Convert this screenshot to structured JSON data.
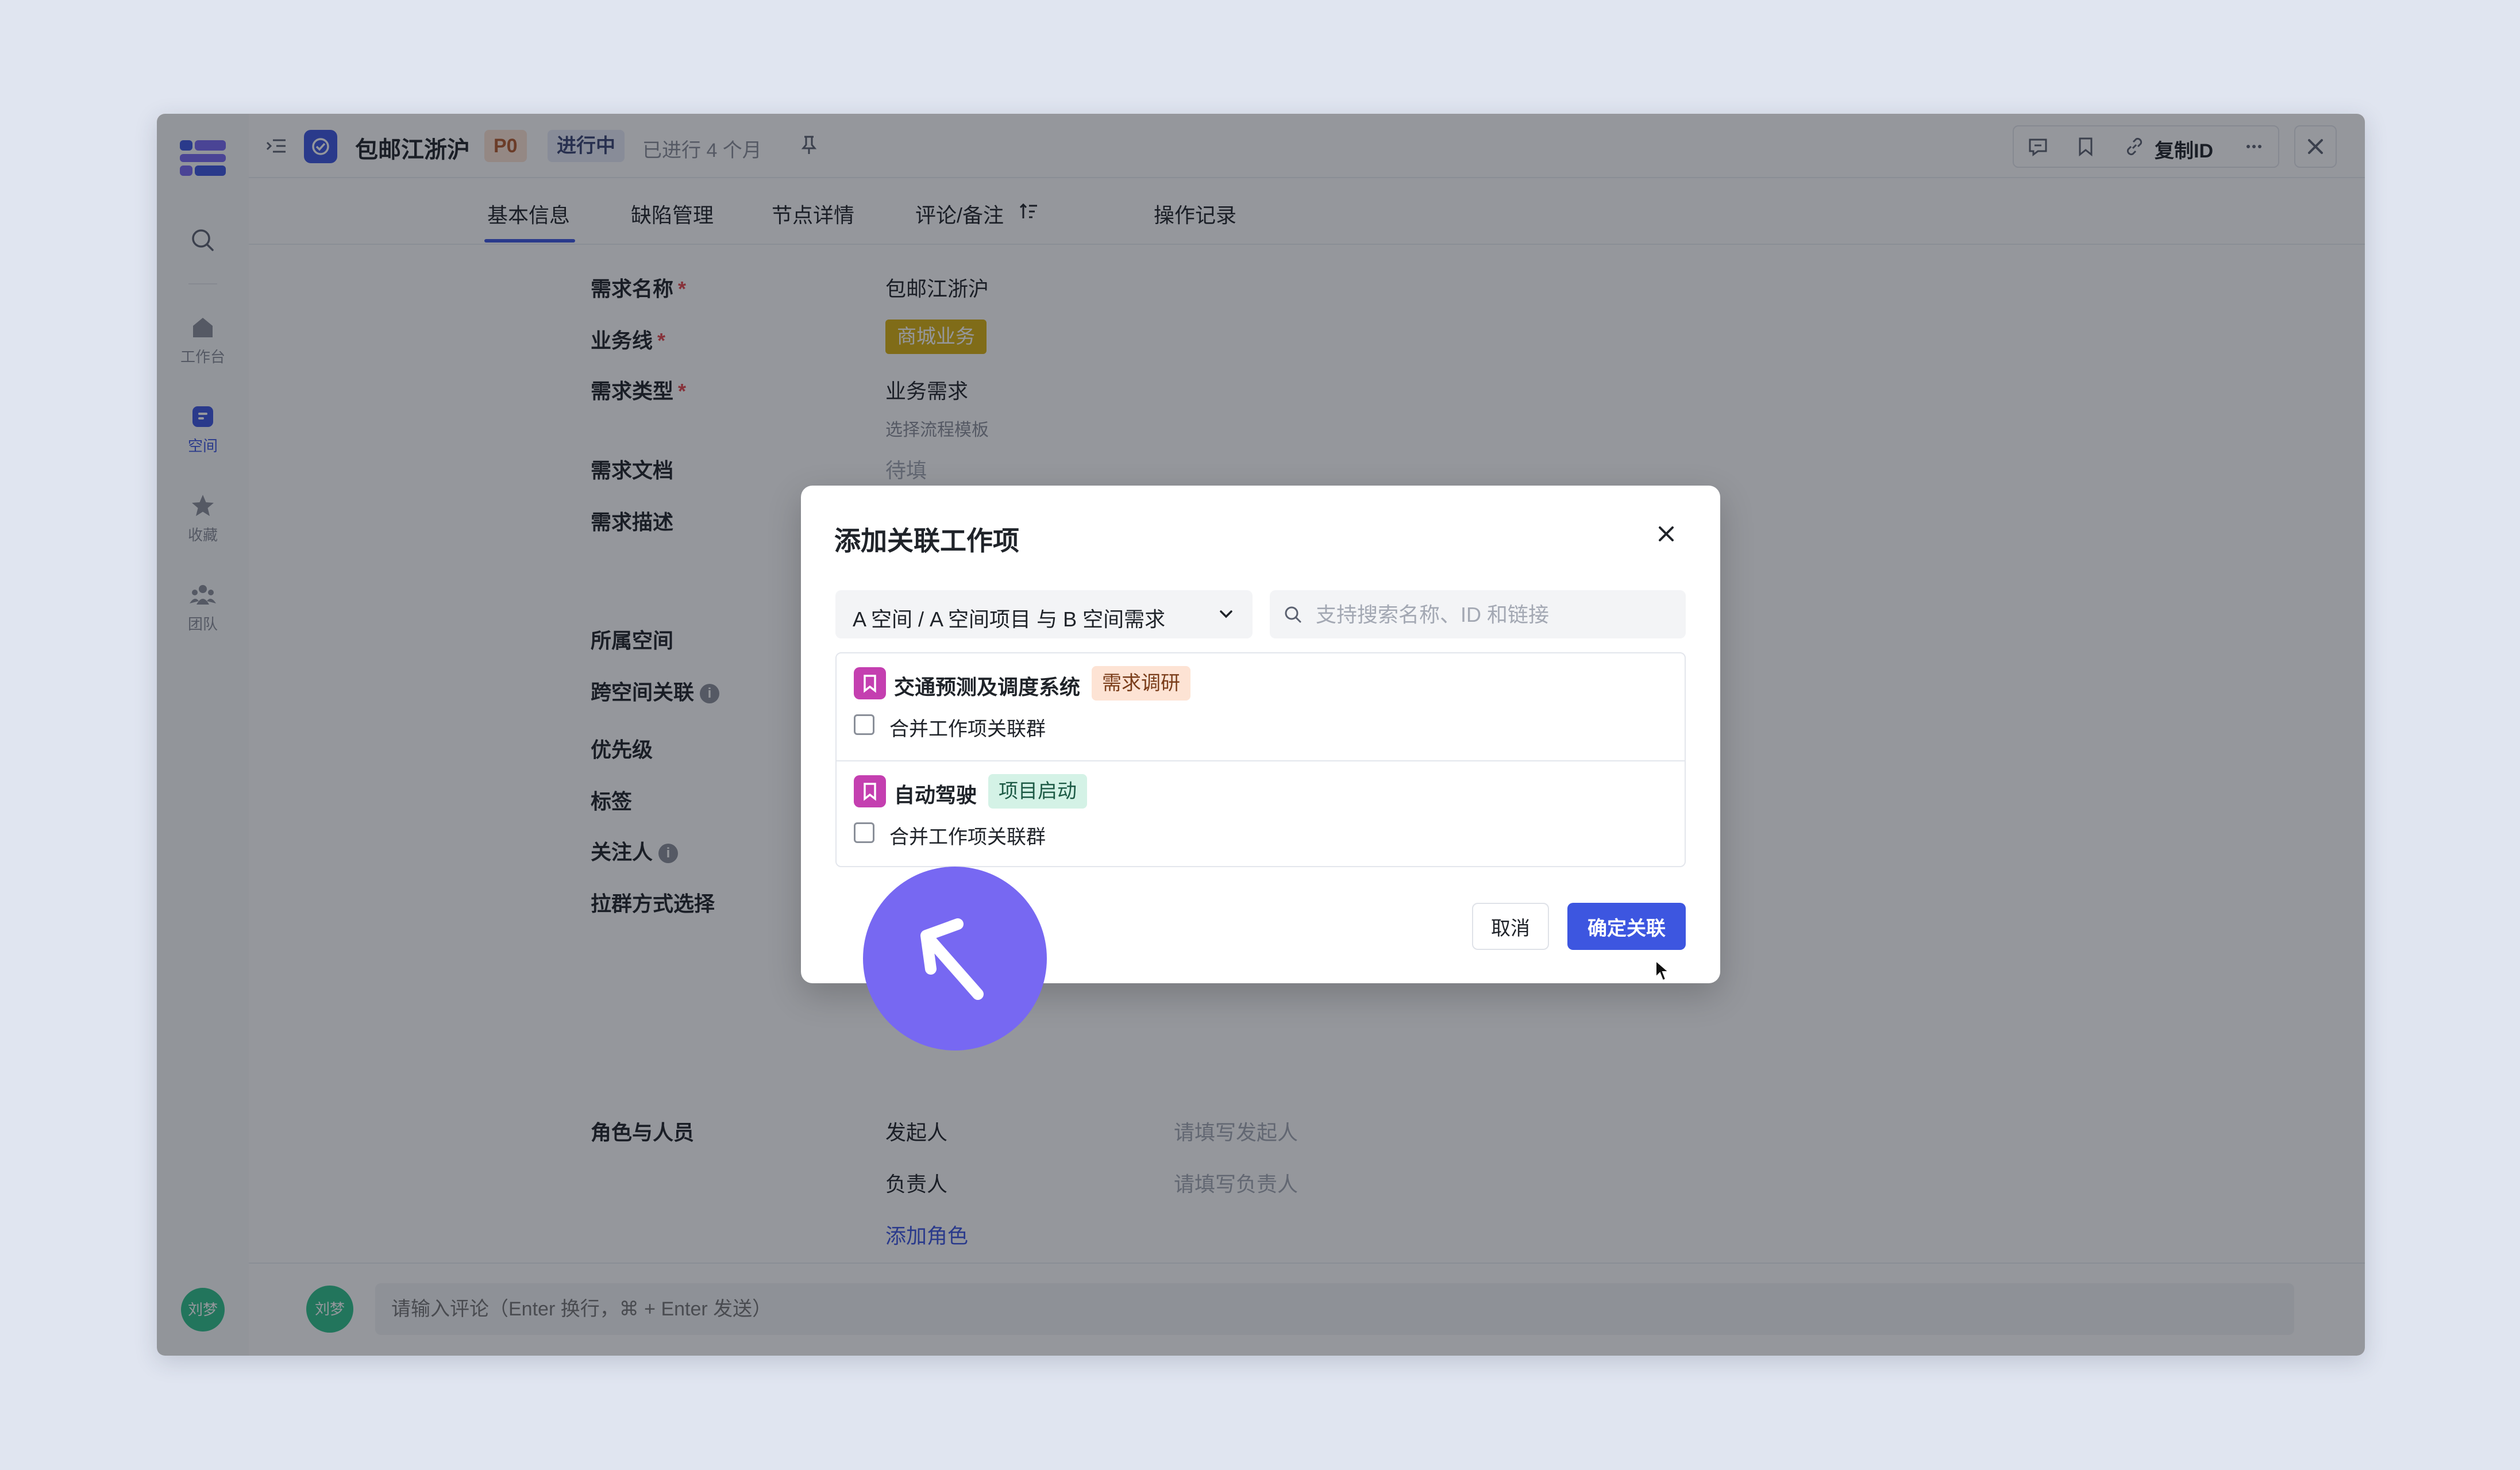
{
  "topbar": {
    "title": "包邮江浙沪",
    "priority": "P0",
    "status": "进行中",
    "elapsed": "已进行 4 个月",
    "copy_id_label": "复制ID"
  },
  "rail": {
    "items": [
      {
        "label": "工作台"
      },
      {
        "label": "空间"
      },
      {
        "label": "收藏"
      },
      {
        "label": "团队"
      }
    ],
    "avatar": "刘梦"
  },
  "tabs": [
    "基本信息",
    "缺陷管理",
    "节点详情",
    "评论/备注",
    "操作记录"
  ],
  "form": {
    "name_label": "需求名称",
    "name_value": "包邮江浙沪",
    "line_label": "业务线",
    "line_value": "商城业务",
    "type_label": "需求类型",
    "type_value": "业务需求",
    "type_hint": "选择流程模板",
    "doc_label": "需求文档",
    "doc_value": "待填",
    "desc_label": "需求描述",
    "space_label": "所属空间",
    "cross_label": "跨空间关联",
    "priority_label": "优先级",
    "tag_label": "标签",
    "follower_label": "关注人",
    "group_label": "拉群方式选择",
    "roles_label": "角色与人员",
    "initiator_label": "发起人",
    "initiator_placeholder": "请填写发起人",
    "owner_label": "负责人",
    "owner_placeholder": "请填写负责人",
    "add_role": "添加角色"
  },
  "comment": {
    "avatar": "刘梦",
    "placeholder": "请输入评论（Enter 换行，⌘ + Enter 发送）"
  },
  "modal": {
    "title": "添加关联工作项",
    "scope": "A 空间 / A 空间项目 与 B 空间需求",
    "search_placeholder": "支持搜索名称、ID 和链接",
    "results": [
      {
        "name": "交通预测及调度系统",
        "tag": "需求调研",
        "checkbox_label": "合并工作项关联群",
        "checked": false
      },
      {
        "name": "自动驾驶",
        "tag": "项目启动",
        "checkbox_label": "合并工作项关联群",
        "checked": false
      }
    ],
    "cancel": "取消",
    "confirm": "确定关联"
  },
  "colors": {
    "accent": "#3d56e0",
    "business_tag": "#d9b10f",
    "item_icon": "#c43fb0",
    "click_marker": "#7768f2"
  }
}
